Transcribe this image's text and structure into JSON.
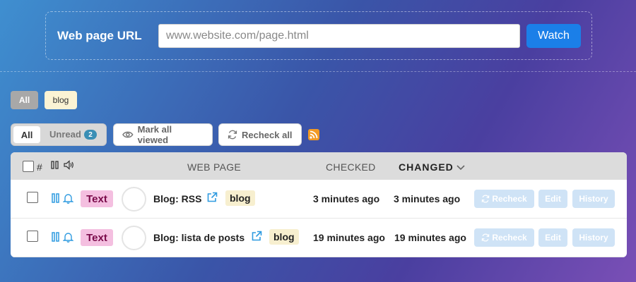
{
  "url_form": {
    "label": "Web page URL",
    "placeholder": "www.website.com/page.html",
    "watch_label": "Watch"
  },
  "tag_filter": {
    "all_label": "All",
    "tags": [
      "blog"
    ]
  },
  "toolbar": {
    "all_label": "All",
    "unread_label": "Unread",
    "unread_count": "2",
    "mark_all_viewed_label": "Mark all viewed",
    "recheck_all_label": "Recheck all"
  },
  "table": {
    "headers": {
      "number": "#",
      "web_page": "WEB PAGE",
      "checked": "CHECKED",
      "changed": "CHANGED"
    },
    "rows": [
      {
        "type": "Text",
        "title": "Blog: RSS",
        "tag": "blog",
        "checked": "3 minutes ago",
        "changed": "3 minutes ago",
        "recheck_label": "Recheck",
        "edit_label": "Edit",
        "history_label": "History"
      },
      {
        "type": "Text",
        "title": "Blog: lista de posts",
        "tag": "blog",
        "checked": "19 minutes ago",
        "changed": "19 minutes ago",
        "recheck_label": "Recheck",
        "edit_label": "Edit",
        "history_label": "History"
      }
    ]
  },
  "colors": {
    "accent": "#1b7fe8",
    "type_badge": "#f4bfe0",
    "tag_bg": "#f7efcf",
    "icon_blue": "#2f9be0"
  }
}
